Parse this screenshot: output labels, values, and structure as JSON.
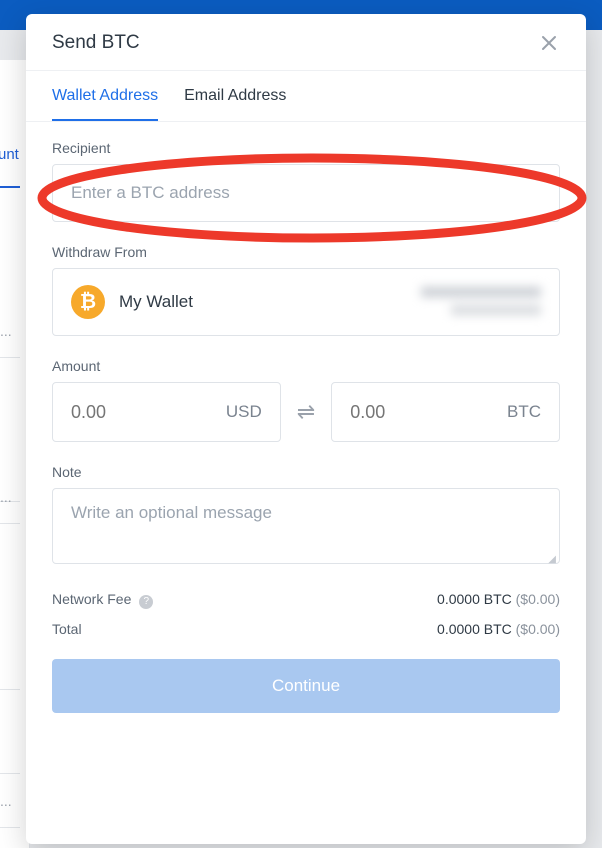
{
  "background": {
    "sidebar_fragment": "unt",
    "row_ellipsis": "..."
  },
  "modal": {
    "title": "Send BTC",
    "tabs": {
      "wallet": "Wallet Address",
      "email": "Email Address"
    },
    "recipient": {
      "label": "Recipient",
      "placeholder": "Enter a BTC address"
    },
    "withdraw": {
      "label": "Withdraw From",
      "wallet_name": "My Wallet",
      "icon_name": "bitcoin-icon"
    },
    "amount": {
      "label": "Amount",
      "fiat_placeholder": "0.00",
      "fiat_unit": "USD",
      "crypto_placeholder": "0.00",
      "crypto_unit": "BTC"
    },
    "note": {
      "label": "Note",
      "placeholder": "Write an optional message"
    },
    "fees": {
      "network_label": "Network Fee",
      "network_value_crypto": "0.0000 BTC",
      "network_value_fiat": "($0.00)",
      "total_label": "Total",
      "total_value_crypto": "0.0000 BTC",
      "total_value_fiat": "($0.00)"
    },
    "continue_label": "Continue"
  },
  "colors": {
    "accent": "#1f6fe8",
    "highlight": "#ed392a",
    "btc": "#f7a92b"
  }
}
